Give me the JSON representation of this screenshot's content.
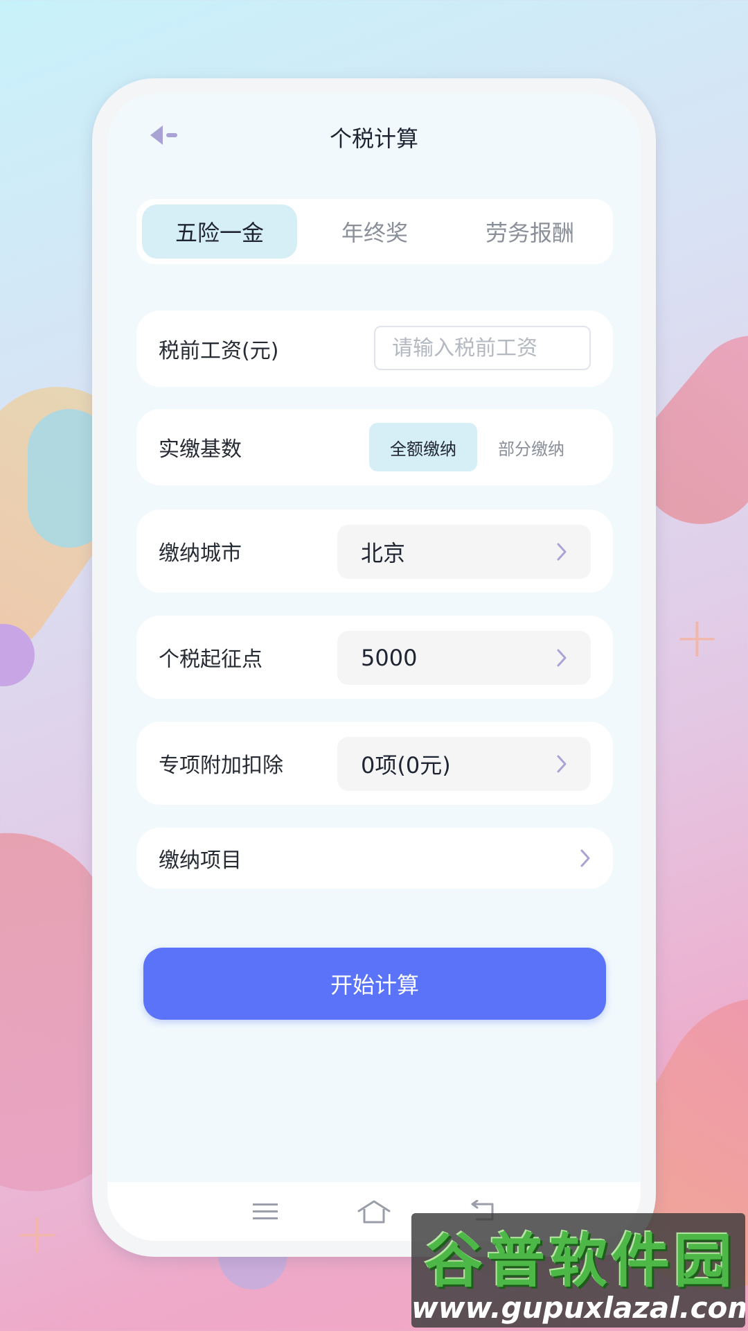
{
  "header": {
    "title": "个税计算"
  },
  "tabs": [
    {
      "label": "五险一金",
      "active": true
    },
    {
      "label": "年终奖",
      "active": false
    },
    {
      "label": "劳务报酬",
      "active": false
    }
  ],
  "form": {
    "salary": {
      "label": "税前工资(元)",
      "placeholder": "请输入税前工资",
      "value": ""
    },
    "base": {
      "label": "实缴基数",
      "options": [
        "全额缴纳",
        "部分缴纳"
      ],
      "selected": "全额缴纳"
    },
    "city": {
      "label": "缴纳城市",
      "value": "北京"
    },
    "threshold": {
      "label": "个税起征点",
      "value": "5000"
    },
    "deduction": {
      "label": "专项附加扣除",
      "value": "0项(0元)"
    },
    "items": {
      "label": "缴纳项目"
    }
  },
  "actions": {
    "calculate": "开始计算"
  },
  "navbar": {
    "icons": [
      "menu-icon",
      "home-icon",
      "back-icon"
    ]
  },
  "watermark": {
    "title": "谷普软件园",
    "url": "www.gupuxlazal.com"
  },
  "colors": {
    "accent": "#5b73f8",
    "tab_active_bg": "#d6eff6",
    "screen_bg": "#f1f9fc",
    "chevron": "#a9a3d6",
    "back_icon": "#a8a3d4"
  }
}
